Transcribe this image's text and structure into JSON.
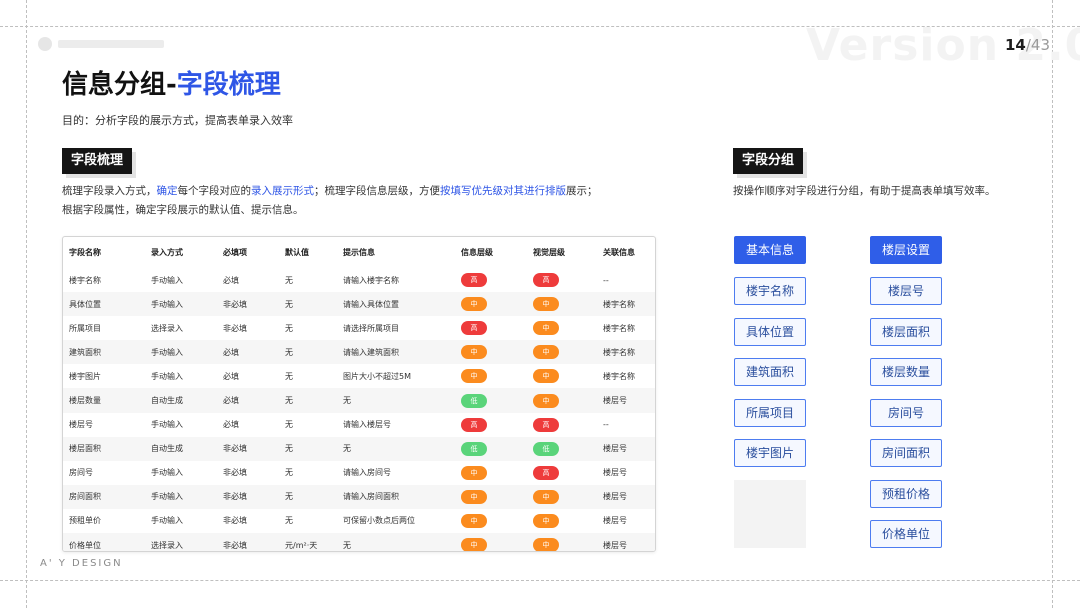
{
  "header": {
    "version_watermark": "Version 2.0",
    "page_current": "14",
    "page_total": "/43"
  },
  "title": {
    "main": "信息分组-",
    "accent": "字段梳理"
  },
  "subtitle": "目的：分析字段的展示方式，提高表单录入效率",
  "left_section": {
    "badge": "字段梳理",
    "desc_line1_a": "梳理字段录入方式，",
    "desc_line1_b": "确定",
    "desc_line1_c": "每个字段对应的",
    "desc_line1_d": "录入展示形式",
    "desc_line1_e": "；梳理字段信息层级，方便",
    "desc_line1_f": "按填写优先级对其进行排版",
    "desc_line1_g": "展示；",
    "desc_line2": "根据字段属性，确定字段展示的默认值、提示信息。"
  },
  "table": {
    "columns": [
      "字段名称",
      "录入方式",
      "必填项",
      "默认值",
      "提示信息",
      "信息层级",
      "视觉层级",
      "关联信息"
    ],
    "rows": [
      {
        "name": "楼宇名称",
        "mode": "手动输入",
        "required": "必填",
        "default": "无",
        "hint": "请输入楼宇名称",
        "info": "高",
        "info_level": "hi",
        "visual": "高",
        "visual_level": "hi",
        "related": "--"
      },
      {
        "name": "具体位置",
        "mode": "手动输入",
        "required": "非必填",
        "default": "无",
        "hint": "请输入具体位置",
        "info": "中",
        "info_level": "mid",
        "visual": "中",
        "visual_level": "mid",
        "related": "楼宇名称"
      },
      {
        "name": "所属项目",
        "mode": "选择录入",
        "required": "非必填",
        "default": "无",
        "hint": "请选择所属项目",
        "info": "高",
        "info_level": "hi",
        "visual": "中",
        "visual_level": "mid",
        "related": "楼宇名称"
      },
      {
        "name": "建筑面积",
        "mode": "手动输入",
        "required": "必填",
        "default": "无",
        "hint": "请输入建筑面积",
        "info": "中",
        "info_level": "mid",
        "visual": "中",
        "visual_level": "mid",
        "related": "楼宇名称"
      },
      {
        "name": "楼宇图片",
        "mode": "手动输入",
        "required": "必填",
        "default": "无",
        "hint": "图片大小不超过5M",
        "info": "中",
        "info_level": "mid",
        "visual": "中",
        "visual_level": "mid",
        "related": "楼宇名称"
      },
      {
        "name": "楼层数量",
        "mode": "自动生成",
        "required": "必填",
        "default": "无",
        "hint": "无",
        "info": "低",
        "info_level": "low",
        "visual": "中",
        "visual_level": "mid",
        "related": "楼层号"
      },
      {
        "name": "楼层号",
        "mode": "手动输入",
        "required": "必填",
        "default": "无",
        "hint": "请输入楼层号",
        "info": "高",
        "info_level": "hi",
        "visual": "高",
        "visual_level": "hi",
        "related": "--"
      },
      {
        "name": "楼层面积",
        "mode": "自动生成",
        "required": "非必填",
        "default": "无",
        "hint": "无",
        "info": "低",
        "info_level": "low",
        "visual": "低",
        "visual_level": "low",
        "related": "楼层号"
      },
      {
        "name": "房间号",
        "mode": "手动输入",
        "required": "非必填",
        "default": "无",
        "hint": "请输入房间号",
        "info": "中",
        "info_level": "mid",
        "visual": "高",
        "visual_level": "hi",
        "related": "楼层号"
      },
      {
        "name": "房间面积",
        "mode": "手动输入",
        "required": "非必填",
        "default": "无",
        "hint": "请输入房间面积",
        "info": "中",
        "info_level": "mid",
        "visual": "中",
        "visual_level": "mid",
        "related": "楼层号"
      },
      {
        "name": "预租单价",
        "mode": "手动输入",
        "required": "非必填",
        "default": "无",
        "hint": "可保留小数点后两位",
        "info": "中",
        "info_level": "mid",
        "visual": "中",
        "visual_level": "mid",
        "related": "楼层号"
      },
      {
        "name": "价格单位",
        "mode": "选择录入",
        "required": "非必填",
        "default": "元/m²·天",
        "hint": "无",
        "info": "中",
        "info_level": "mid",
        "visual": "中",
        "visual_level": "mid",
        "related": "楼层号"
      }
    ]
  },
  "right_section": {
    "badge": "字段分组",
    "desc": "按操作顺序对字段进行分组，有助于提高表单填写效率。",
    "group_a": {
      "header": "基本信息",
      "fields": [
        "楼宇名称",
        "具体位置",
        "建筑面积",
        "所属项目",
        "楼宇图片"
      ]
    },
    "group_b": {
      "header": "楼层设置",
      "fields": [
        "楼层号",
        "楼层面积",
        "楼层数量",
        "房间号",
        "房间面积",
        "预租价格",
        "价格单位"
      ]
    }
  },
  "footer": {
    "brand": "A' Y DESIGN"
  },
  "colors": {
    "accent": "#2f56e6",
    "high": "#ee3b3b",
    "medium": "#fb8b1e",
    "low": "#5ad47a"
  }
}
